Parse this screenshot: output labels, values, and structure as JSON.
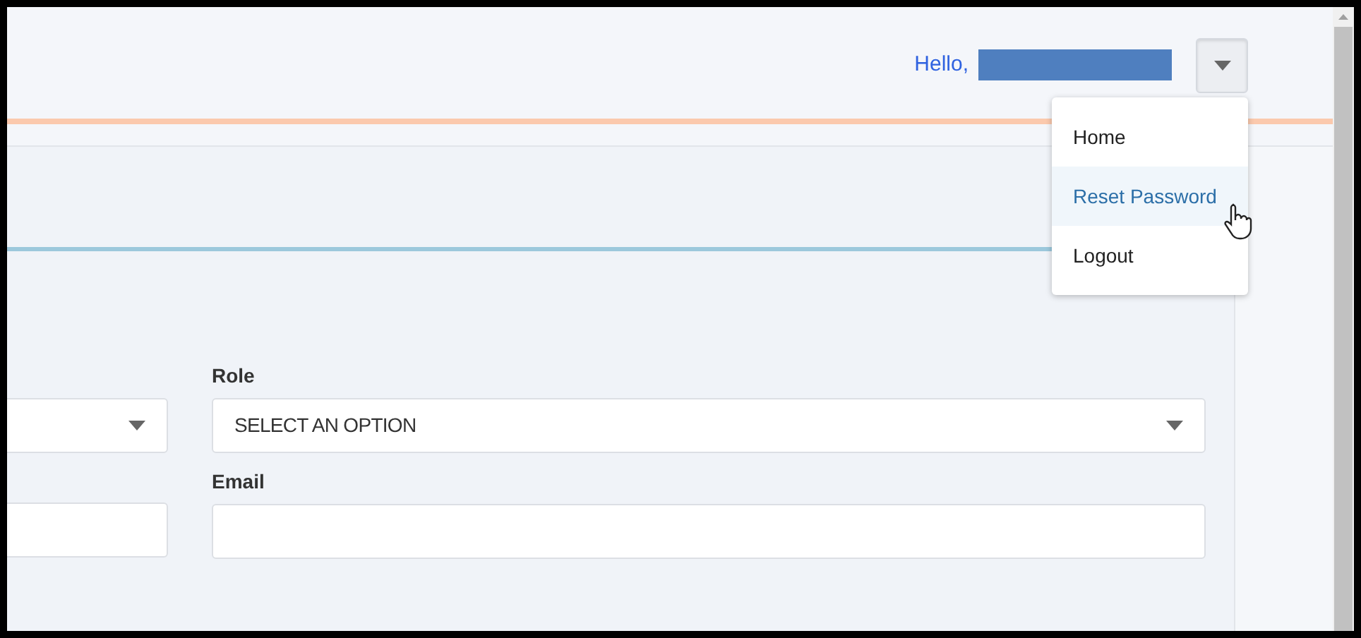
{
  "header": {
    "greeting": "Hello,",
    "user_menu": {
      "expanded": true,
      "items": [
        {
          "label": "Home",
          "highlighted": false
        },
        {
          "label": "Reset Password",
          "highlighted": true
        },
        {
          "label": "Logout",
          "highlighted": false
        }
      ]
    }
  },
  "form": {
    "left_fields": [
      {
        "kind": "select"
      },
      {
        "kind": "text"
      }
    ],
    "fields": [
      {
        "kind": "select",
        "label": "Role",
        "value": "SELECT AN OPTION"
      },
      {
        "kind": "text",
        "label": "Email"
      }
    ]
  }
}
